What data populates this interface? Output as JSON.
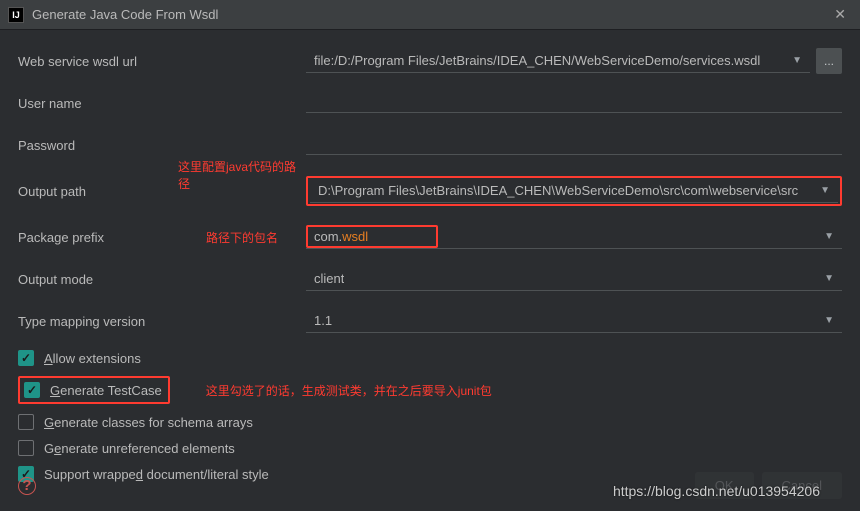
{
  "titlebar": {
    "app_glyph": "IJ",
    "title": "Generate Java Code From Wsdl",
    "close": "✕"
  },
  "labels": {
    "wsdl_url": "Web service wsdl url",
    "user_name": "User name",
    "password": "Password",
    "output_path": "Output path",
    "package_prefix": "Package prefix",
    "output_mode": "Output mode",
    "type_mapping": "Type mapping version"
  },
  "fields": {
    "wsdl_url": "file:/D:/Program Files/JetBrains/IDEA_CHEN/WebServiceDemo/services.wsdl",
    "user_name": "",
    "password": "",
    "output_path": "D:\\Program Files\\JetBrains\\IDEA_CHEN\\WebServiceDemo\\src\\com\\webservice\\src",
    "package_prefix_pre": "com.",
    "package_prefix_hl": "wsdl",
    "output_mode": "client",
    "type_mapping": "1.1"
  },
  "checkboxes": {
    "allow_ext": {
      "label_pre": "",
      "mn": "A",
      "label_post": "llow extensions",
      "checked": true
    },
    "gen_tc": {
      "label_pre": "",
      "mn": "G",
      "label_post": "enerate TestCase",
      "checked": true
    },
    "gen_sch": {
      "label_pre": "",
      "mn": "G",
      "label_post": "enerate classes for schema arrays",
      "checked": false
    },
    "gen_unref": {
      "label_pre": "G",
      "mn": "e",
      "label_post": "nerate unreferenced elements",
      "checked": false
    },
    "supp_wrap": {
      "label_pre": "Support wrappe",
      "mn": "d",
      "label_post": " document/literal style",
      "checked": true
    }
  },
  "annotations": {
    "output_path": "这里配置java代码的路径",
    "package": "路径下的包名",
    "testcase": "这里勾选了的话，生成测试类，并在之后要导入junit包"
  },
  "buttons": {
    "ok": "OK",
    "cancel": "Cancel"
  },
  "misc": {
    "ellipsis": "...",
    "help": "?",
    "caret": "▼"
  },
  "watermark": "https://blog.csdn.net/u013954206"
}
